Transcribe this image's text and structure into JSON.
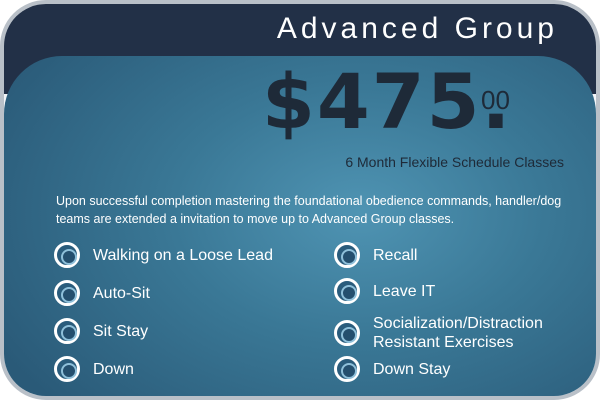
{
  "header": {
    "title": "Advanced Group"
  },
  "pricing": {
    "dollars": "$475.",
    "cents": "00",
    "schedule": "6 Month Flexible Schedule Classes"
  },
  "description": "Upon successful completion mastering the foundational obedience commands, handler/dog teams are extended a invitation to move up to Advanced Group classes.",
  "skills_left": [
    "Walking on a Loose Lead",
    "Auto-Sit",
    "Sit Stay",
    "Down"
  ],
  "skills_right": [
    "Recall",
    "Leave IT",
    "Socialization/Distraction Resistant Exercises",
    "Down Stay"
  ],
  "colors": {
    "header_navy": "#223047",
    "panel_blue": "#3a7896",
    "price_text": "#1e2a38",
    "bullet_ring": "#ffffff"
  }
}
